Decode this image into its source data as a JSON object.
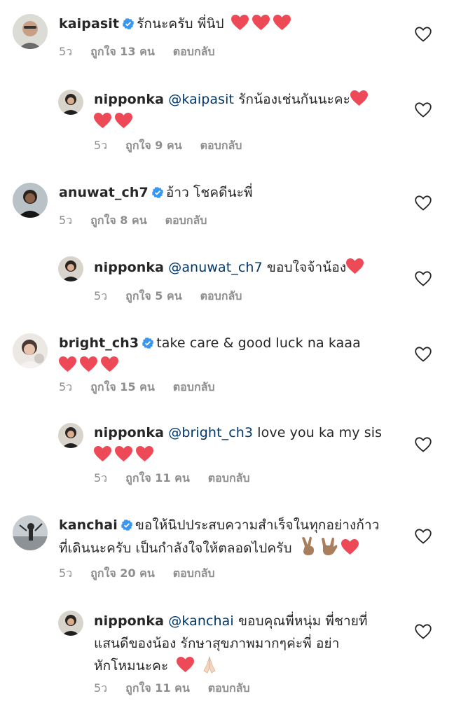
{
  "comments": [
    {
      "username": "kaipasit",
      "verified": true,
      "text": "รักนะครับ พี่นิป",
      "time": "5ว",
      "likes": "ถูกใจ 13 คน",
      "reply_label": "ตอบกลับ",
      "hearts": 3
    },
    {
      "username": "nipponka",
      "mention": "@kaipasit",
      "text": "รักน้องเช่นกันนะคะ",
      "time": "5ว",
      "likes": "ถูกใจ 9 คน",
      "reply_label": "ตอบกลับ",
      "hearts": 3
    },
    {
      "username": "anuwat_ch7",
      "verified": true,
      "text": "อ้าว โชคดีนะพี่",
      "time": "5ว",
      "likes": "ถูกใจ 8 คน",
      "reply_label": "ตอบกลับ"
    },
    {
      "username": "nipponka",
      "mention": "@anuwat_ch7",
      "text": "ขอบใจจ้าน้อง",
      "time": "5ว",
      "likes": "ถูกใจ 5 คน",
      "reply_label": "ตอบกลับ",
      "hearts": 1
    },
    {
      "username": "bright_ch3",
      "verified": true,
      "text": "take care & good luck na kaaa",
      "time": "5ว",
      "likes": "ถูกใจ 15 คน",
      "reply_label": "ตอบกลับ",
      "hearts": 3
    },
    {
      "username": "nipponka",
      "mention": "@bright_ch3",
      "text": "love you ka my sis",
      "time": "5ว",
      "likes": "ถูกใจ 11 คน",
      "reply_label": "ตอบกลับ",
      "hearts": 3
    },
    {
      "username": "kanchai",
      "verified": true,
      "text_line1": "ขอให้นิปประสบความสำเร็จในทุกอย่างก้าว",
      "text_line2": "ที่เดินนะครับ เป็นกำลังใจให้ตลอดไปครับ",
      "emojis": [
        "victory-hand",
        "rock-on-hand"
      ],
      "hearts": 1,
      "time": "5ว",
      "likes": "ถูกใจ 20 คน",
      "reply_label": "ตอบกลับ"
    },
    {
      "username": "nipponka",
      "mention": "@kanchai",
      "text_line1": "ขอบคุณพี่หนุ่ม พี่ชายที่",
      "text_line2": "แสนดีของน้อง รักษาสุขภาพมากๆค่ะพี่ อย่า",
      "text_line3": "หักโหมนะคะ",
      "hearts": 1,
      "emojis": [
        "folded-hands"
      ],
      "time": "5ว",
      "likes": "ถูกใจ 11 คน",
      "reply_label": "ตอบกลับ"
    }
  ],
  "colors": {
    "text": "#262626",
    "meta": "#8e8e8e",
    "mention": "#00376b",
    "verified": "#3897f0",
    "heart": "#ed4956"
  },
  "icons": {
    "verified": "verified-badge-icon",
    "like": "heart-outline-icon",
    "heart_emoji": "red-heart-emoji"
  }
}
